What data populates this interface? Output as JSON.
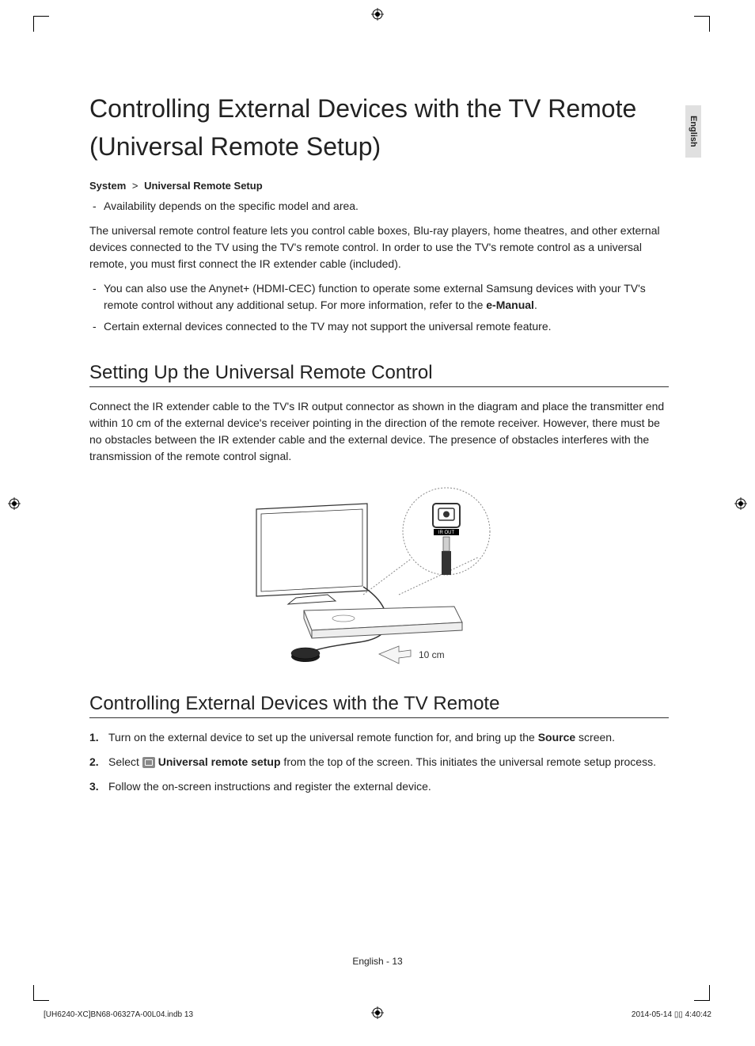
{
  "lang_tab": "English",
  "title": "Controlling External Devices with the TV Remote (Universal Remote Setup)",
  "breadcrumb": {
    "a": "System",
    "b": "Universal Remote Setup"
  },
  "intro_bullet": "Availability depends on the specific model and area.",
  "intro_para": "The universal remote control feature lets you control cable boxes, Blu-ray players, home theatres, and other external devices connected to the TV using the TV's remote control. In order to use the TV's remote control as a universal remote, you must first connect the IR extender cable (included).",
  "intro_bullets2": {
    "b1_pre": "You can also use the Anynet+ (HDMI-CEC) function to operate some external Samsung devices with your TV's remote control without any additional setup. For more information, refer to the ",
    "b1_bold": "e-Manual",
    "b1_post": ".",
    "b2": "Certain external devices connected to the TV may not support the universal remote feature."
  },
  "section1": {
    "heading": "Setting Up the Universal Remote Control",
    "para": "Connect the IR extender cable to the TV's IR output connector as shown in the diagram and place the transmitter end within 10 cm of the external device's receiver pointing in the direction of the remote receiver. However, there must be no obstacles between the IR extender cable and the external device. The presence of obstacles interferes with the transmission of the remote control signal."
  },
  "diagram": {
    "ir_out": "IR OUT",
    "distance": "10 cm"
  },
  "section2": {
    "heading": "Controlling External Devices with the TV Remote",
    "step1_pre": "Turn on the external device to set up the universal remote function for, and bring up the ",
    "step1_bold": "Source",
    "step1_post": " screen.",
    "step2_pre": "Select ",
    "step2_bold": " Universal remote setup",
    "step2_post": " from the top of the screen. This initiates the universal remote setup process.",
    "step3": "Follow the on-screen instructions and register the external device."
  },
  "footer": "English - 13",
  "imprint_left": "[UH6240-XC]BN68-06327A-00L04.indb   13",
  "imprint_right": "2014-05-14   ▯▯ 4:40:42"
}
